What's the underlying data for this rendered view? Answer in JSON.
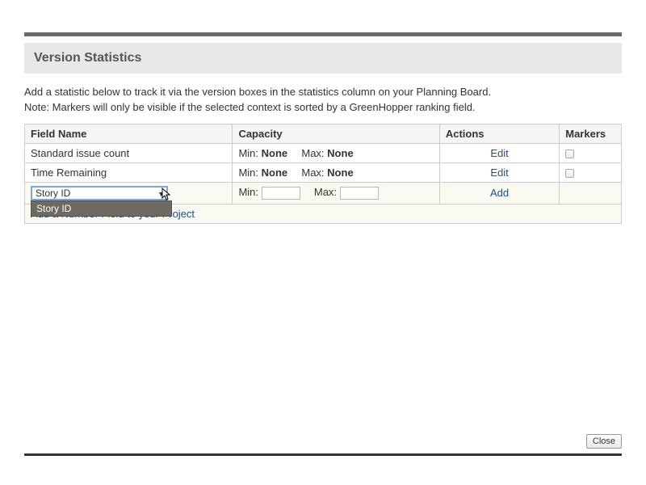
{
  "panel": {
    "title": "Version Statistics"
  },
  "description": {
    "line1": "Add a statistic below to track it via the version boxes in the statistics column on your Planning Board.",
    "line2": "Note: Markers will only be visible if the selected context is sorted by a GreenHopper ranking field."
  },
  "columns": {
    "field": "Field Name",
    "capacity": "Capacity",
    "actions": "Actions",
    "markers": "Markers"
  },
  "capacity_labels": {
    "min": "Min:",
    "max": "Max:"
  },
  "rows": [
    {
      "field": "Standard issue count",
      "min": "None",
      "max": "None",
      "action": "Edit",
      "marker": true
    },
    {
      "field": "Time Remaining",
      "min": "None",
      "max": "None",
      "action": "Edit",
      "marker": true
    }
  ],
  "add_row": {
    "select_value": "Story ID",
    "dropdown_option": "Story ID",
    "min_value": "",
    "max_value": "",
    "action": "Add"
  },
  "footer_link": "Add a Number Field to your Project",
  "close": "Close"
}
